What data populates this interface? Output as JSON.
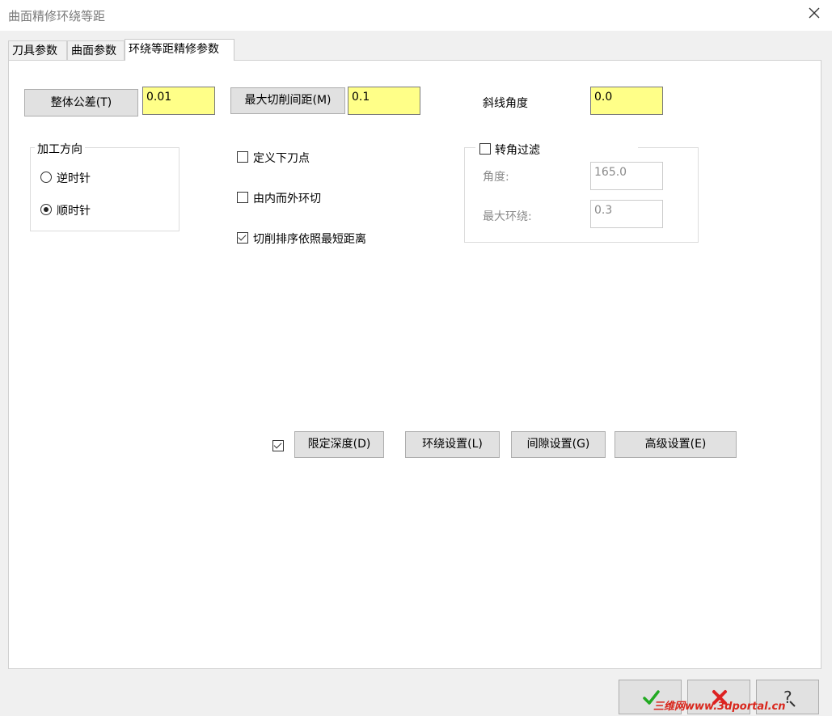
{
  "window": {
    "title": "曲面精修环绕等距"
  },
  "tabs": [
    {
      "label": "刀具参数"
    },
    {
      "label": "曲面参数"
    },
    {
      "label": "环绕等距精修参数"
    }
  ],
  "top_row": {
    "tolerance_button": "整体公差(T)",
    "tolerance_value": "0.01",
    "max_stepover_button": "最大切削间距(M)",
    "max_stepover_value": "0.1",
    "ramp_angle_label": "斜线角度",
    "ramp_angle_value": "0.0"
  },
  "direction_group": {
    "title": "加工方向",
    "options": [
      {
        "label": "逆时针",
        "checked": false
      },
      {
        "label": "顺时针",
        "checked": true
      }
    ]
  },
  "options": [
    {
      "label": "定义下刀点",
      "checked": false
    },
    {
      "label": "由内而外环切",
      "checked": false
    },
    {
      "label": "切削排序依照最短距离",
      "checked": true
    }
  ],
  "corner_filter": {
    "title": "转角过滤",
    "checked": false,
    "angle_label": "角度:",
    "angle_value": "165.0",
    "max_loop_label": "最大环绕:",
    "max_loop_value": "0.3"
  },
  "action_row": {
    "depth_checked": true,
    "depth_button": "限定深度(D)",
    "loop_button": "环绕设置(L)",
    "gap_button": "间隙设置(G)",
    "advanced_button": "高级设置(E)"
  },
  "footer": {
    "watermark": "三维网www.3dportal.cn",
    "colors": {
      "ok": "#22aa22",
      "cancel": "#dd2222",
      "help": "#333333"
    }
  }
}
